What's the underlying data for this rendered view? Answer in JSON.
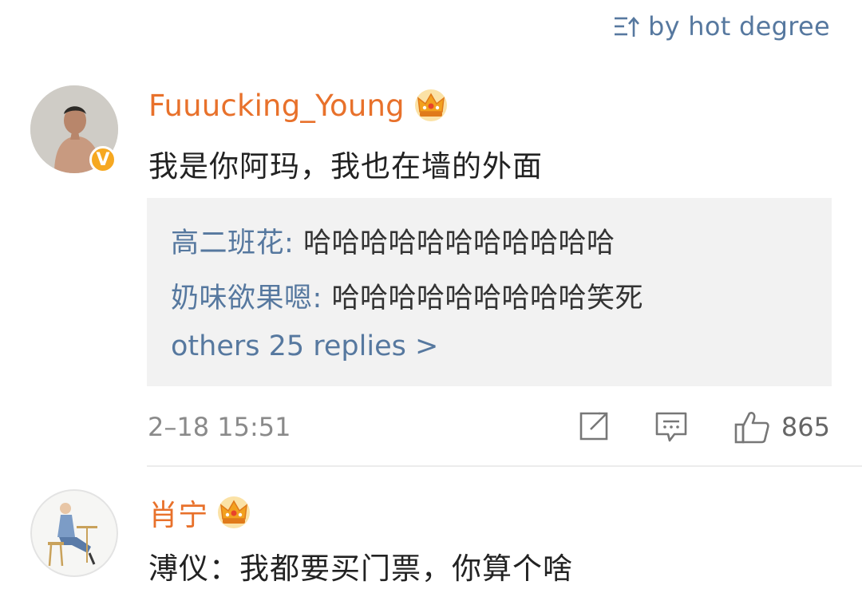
{
  "sort": {
    "label": "by hot degree",
    "icon": "sort-icon"
  },
  "comments": [
    {
      "username": "Fuuucking_Young",
      "verified_badge": "V",
      "text": "我是你阿玛，我也在墙的外面",
      "replies": [
        {
          "user": "高二班花",
          "sep": ": ",
          "text": "哈哈哈哈哈哈哈哈哈哈哈"
        },
        {
          "user": "奶味欲果嗯",
          "sep": ": ",
          "text": "哈哈哈哈哈哈哈哈哈笑死"
        }
      ],
      "more_replies": "others 25 replies >",
      "timestamp": "2–18 15:51",
      "likes": "865"
    },
    {
      "username": "肖宁",
      "text": "溥仪：我都要买门票，你算个啥"
    }
  ],
  "colors": {
    "username": "#e8712b",
    "link": "#56789f",
    "reply_bg": "#f2f2f2",
    "badge": "#f6a821"
  }
}
